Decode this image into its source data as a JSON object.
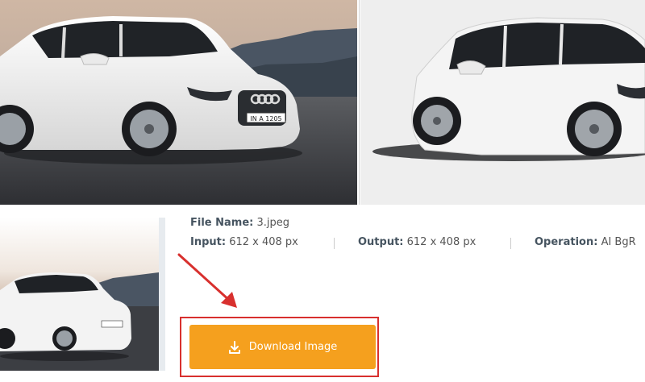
{
  "previews": {
    "original_image": "car-photo-original",
    "result_image": "car-photo-background-removed"
  },
  "file_info": {
    "file_name_label": "File Name:",
    "file_name_value": "3.jpeg",
    "input_label": "Input:",
    "input_value": "612 x 408 px",
    "output_label": "Output:",
    "output_value": "612 x 408 px",
    "operation_label": "Operation:",
    "operation_value": "AI BgR"
  },
  "download": {
    "label": "Download Image",
    "icon": "download-icon"
  },
  "colors": {
    "button": "#f5a01e",
    "highlight": "#d8302e",
    "arrow": "#d8302e",
    "label": "#465460"
  }
}
